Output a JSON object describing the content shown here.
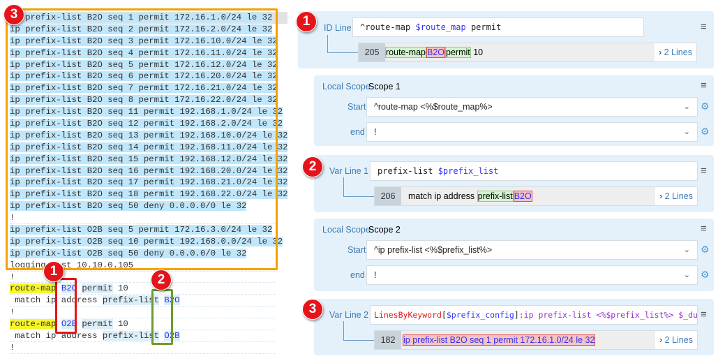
{
  "code_lines": [
    [
      {
        "t": "ip prefix-list ",
        "c": "sel"
      },
      {
        "t": "B2O",
        "c": "sel"
      },
      {
        "t": " seq 1 permit 172.16.1.0/24 le 32",
        "c": "sel"
      }
    ],
    [
      {
        "t": "ip prefix-list B2O seq 2 permit 172.16.2.0/24 le 32",
        "c": "sel"
      }
    ],
    [
      {
        "t": "ip prefix-list B2O seq 3 permit 172.16.10.0/24 le 32",
        "c": "sel"
      }
    ],
    [
      {
        "t": "ip prefix-list B2O seq 4 permit 172.16.11.0/24 le 32",
        "c": "sel"
      }
    ],
    [
      {
        "t": "ip prefix-list B2O seq 5 permit 172.16.12.0/24 le 32",
        "c": "sel"
      }
    ],
    [
      {
        "t": "ip prefix-list B2O seq 6 permit 172.16.20.0/24 le 32",
        "c": "sel"
      }
    ],
    [
      {
        "t": "ip prefix-list B2O seq 7 permit 172.16.21.0/24 le 32",
        "c": "sel"
      }
    ],
    [
      {
        "t": "ip prefix-list B2O seq 8 permit 172.16.22.0/24 le 32",
        "c": "sel"
      }
    ],
    [
      {
        "t": "ip prefix-list B2O seq 11 permit 192.168.1.0/24 le 32",
        "c": "sel"
      }
    ],
    [
      {
        "t": "ip prefix-list B2O seq 12 permit 192.168.2.0/24 le 32",
        "c": "sel"
      }
    ],
    [
      {
        "t": "ip prefix-list B2O seq 13 permit 192.168.10.0/24 le 32",
        "c": "sel"
      }
    ],
    [
      {
        "t": "ip prefix-list B2O seq 14 permit 192.168.11.0/24 le 32",
        "c": "sel"
      }
    ],
    [
      {
        "t": "ip prefix-list B2O seq 15 permit 192.168.12.0/24 le 32",
        "c": "sel"
      }
    ],
    [
      {
        "t": "ip prefix-list B2O seq 16 permit 192.168.20.0/24 le 32",
        "c": "sel"
      }
    ],
    [
      {
        "t": "ip prefix-list B2O seq 17 permit 192.168.21.0/24 le 32",
        "c": "sel"
      }
    ],
    [
      {
        "t": "ip prefix-list B2O seq 18 permit 192.168.22.0/24 le 32",
        "c": "sel"
      }
    ],
    [
      {
        "t": "ip prefix-list B2O seq 50 deny 0.0.0.0/0 le 32",
        "c": "sel"
      }
    ],
    [
      {
        "t": "!",
        "c": ""
      }
    ],
    [
      {
        "t": "ip prefix-list O2B seq 5 permit 172.16.3.0/24 le 32",
        "c": "sel"
      }
    ],
    [
      {
        "t": "ip prefix-list O2B seq 10 permit 192.168.0.0/24 le 32",
        "c": "sel"
      }
    ],
    [
      {
        "t": "ip prefix-list O2B seq 50 deny 0.0.0.0/0 le 32",
        "c": "sel"
      }
    ],
    [
      {
        "t": "logging host 10.10.0.105",
        "c": ""
      }
    ],
    [
      {
        "t": "!",
        "c": ""
      }
    ],
    [
      {
        "t": "route-map",
        "c": "hy"
      },
      {
        "t": " ",
        "c": ""
      },
      {
        "t": "B2O",
        "c": "hb"
      },
      {
        "t": " ",
        "c": ""
      },
      {
        "t": "permit",
        "c": "hp"
      },
      {
        "t": " 10",
        "c": ""
      }
    ],
    [
      {
        "t": " match ip address ",
        "c": ""
      },
      {
        "t": "prefix-list",
        "c": "hp"
      },
      {
        "t": " ",
        "c": ""
      },
      {
        "t": "B2O",
        "c": "hb"
      }
    ],
    [
      {
        "t": "!",
        "c": ""
      }
    ],
    [
      {
        "t": "route-map",
        "c": "hy"
      },
      {
        "t": " ",
        "c": ""
      },
      {
        "t": "O2B",
        "c": "hb"
      },
      {
        "t": " ",
        "c": ""
      },
      {
        "t": "permit",
        "c": "hp"
      },
      {
        "t": " 10",
        "c": ""
      }
    ],
    [
      {
        "t": " match ip address ",
        "c": ""
      },
      {
        "t": "prefix-list",
        "c": "hp"
      },
      {
        "t": " ",
        "c": ""
      },
      {
        "t": "O2B",
        "c": "hb"
      }
    ],
    [
      {
        "t": "!",
        "c": ""
      }
    ]
  ],
  "badges": {
    "left_3": "3",
    "left_1": "1",
    "left_2": "2",
    "right_1": "1",
    "right_2": "2",
    "right_3": "3"
  },
  "colors": {
    "orange_box": "#f5a000",
    "red_box": "#e5141b",
    "green_box": "#6e9a2e",
    "badge": "#e5141b"
  },
  "id_line": {
    "label": "ID Line",
    "pattern_a": "^route-map ",
    "pattern_var": "$route_map",
    "pattern_b": " permit",
    "result_num": "205",
    "seg1": "route-map",
    "seg2": "B2O",
    "seg3": "permit",
    "seg4": " 10",
    "more": "2 Lines"
  },
  "scope1": {
    "label": "Local Scope",
    "name": "Scope 1",
    "start_label": "Start",
    "start_value": "^route-map <%$route_map%>",
    "end_label": "end",
    "end_value": "!"
  },
  "var1": {
    "label": "Var Line 1",
    "pattern_a": "prefix-list ",
    "pattern_var": "$prefix_list",
    "result_num": "206",
    "seg0": "match ip address ",
    "seg1": "prefix-list",
    "seg2": "B2O",
    "more": "2 Lines"
  },
  "scope2": {
    "label": "Local Scope",
    "name": "Scope 2",
    "start_label": "Start",
    "start_value": "^ip prefix-list <%$prefix_list%>",
    "end_label": "end",
    "end_value": "!"
  },
  "var2": {
    "label": "Var Line 2",
    "p1": "LinesByKeyword",
    "p2": "[",
    "p3": "$prefix_config",
    "p4": "]",
    "p5": ":ip prefix-list <%$prefix_list%> $_dummy",
    "result_num": "182",
    "seg1": "ip prefix-list B2O seq 1 permit 172.16.1.0/24 le 32",
    "more": "2 Lines"
  }
}
